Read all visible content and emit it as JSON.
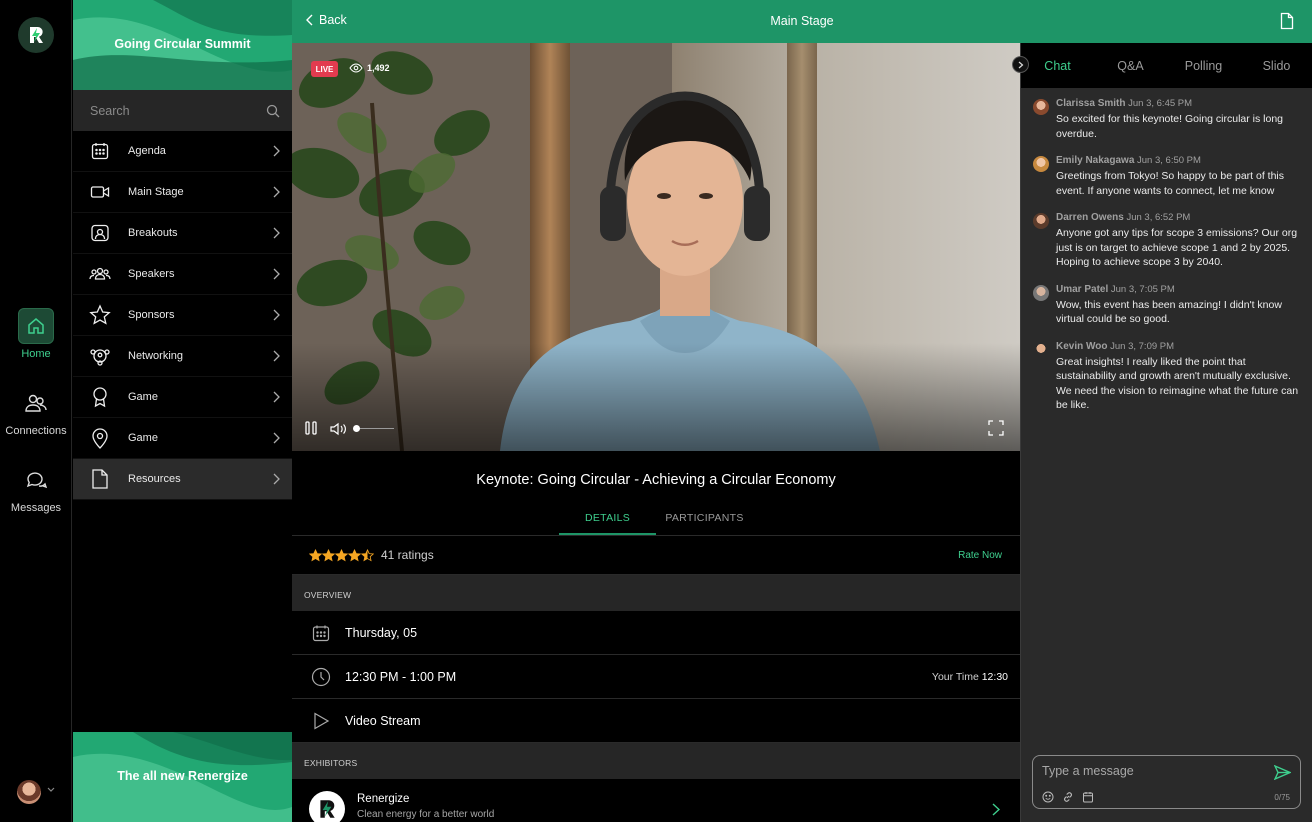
{
  "colors": {
    "accent": "#3ecf8e",
    "brand": "#1e9567",
    "live": "#e23b4f",
    "star": "#f5a623"
  },
  "rail": {
    "items": [
      {
        "label": "Home",
        "icon": "home-icon",
        "active": true
      },
      {
        "label": "Connections",
        "icon": "people-icon",
        "active": false
      },
      {
        "label": "Messages",
        "icon": "chat-bubbles-icon",
        "active": false
      }
    ]
  },
  "sidebar": {
    "banner_title": "Going Circular Summit",
    "search_placeholder": "Search",
    "items": [
      {
        "label": "Agenda",
        "icon": "calendar-icon"
      },
      {
        "label": "Main Stage",
        "icon": "video-camera-icon"
      },
      {
        "label": "Breakouts",
        "icon": "breakout-room-icon"
      },
      {
        "label": "Speakers",
        "icon": "group-icon"
      },
      {
        "label": "Sponsors",
        "icon": "star-icon"
      },
      {
        "label": "Networking",
        "icon": "network-icon"
      },
      {
        "label": "Game",
        "icon": "award-icon"
      },
      {
        "label": "Game",
        "icon": "location-pin-icon"
      },
      {
        "label": "Resources",
        "icon": "document-icon",
        "active": true
      }
    ],
    "footer_title": "The all new Renergize"
  },
  "topbar": {
    "back_label": "Back",
    "title": "Main Stage"
  },
  "video": {
    "live_label": "LIVE",
    "viewers": "1,492",
    "volume": 0.05
  },
  "session": {
    "title": "Keynote: Going Circular - Achieving a Circular Economy",
    "tabs": [
      "DETAILS",
      "PARTICIPANTS"
    ],
    "rating": 4.5,
    "ratings_text": "41 ratings",
    "rate_now": "Rate Now",
    "overview_label": "OVERVIEW",
    "date": "Thursday, 05",
    "time": "12:30 PM - 1:00 PM",
    "your_time_label": "Your Time",
    "your_time_value": "12:30",
    "stream": "Video Stream",
    "exhibitors_label": "EXHIBITORS",
    "exhibitor": {
      "name": "Renergize",
      "tagline": "Clean energy for a better world"
    }
  },
  "panel": {
    "tabs": [
      "Chat",
      "Q&A",
      "Polling",
      "Slido"
    ],
    "messages": [
      {
        "name": "Clarissa Smith",
        "time": "Jun 3, 6:45 PM",
        "text": "So excited for this keynote! Going circular is long overdue."
      },
      {
        "name": "Emily Nakagawa",
        "time": "Jun 3, 6:50 PM",
        "text": "Greetings from Tokyo! So happy to be part of this event. If anyone wants to connect, let me know"
      },
      {
        "name": "Darren Owens",
        "time": "Jun 3, 6:52 PM",
        "text": "Anyone got any tips for scope 3 emissions? Our org just is on target to achieve scope 1 and 2 by 2025. Hoping to achieve scope 3 by 2040."
      },
      {
        "name": "Umar Patel",
        "time": "Jun 3, 7:05 PM",
        "text": "Wow, this event has been amazing! I didn't know virtual could be so good."
      },
      {
        "name": "Kevin Woo",
        "time": "Jun 3, 7:09 PM",
        "text": "Great insights! I really liked the point that sustainability and growth aren't mutually exclusive. We need the vision to reimagine what the future can be like."
      }
    ],
    "composer_placeholder": "Type a message",
    "char_count": "0/75"
  }
}
